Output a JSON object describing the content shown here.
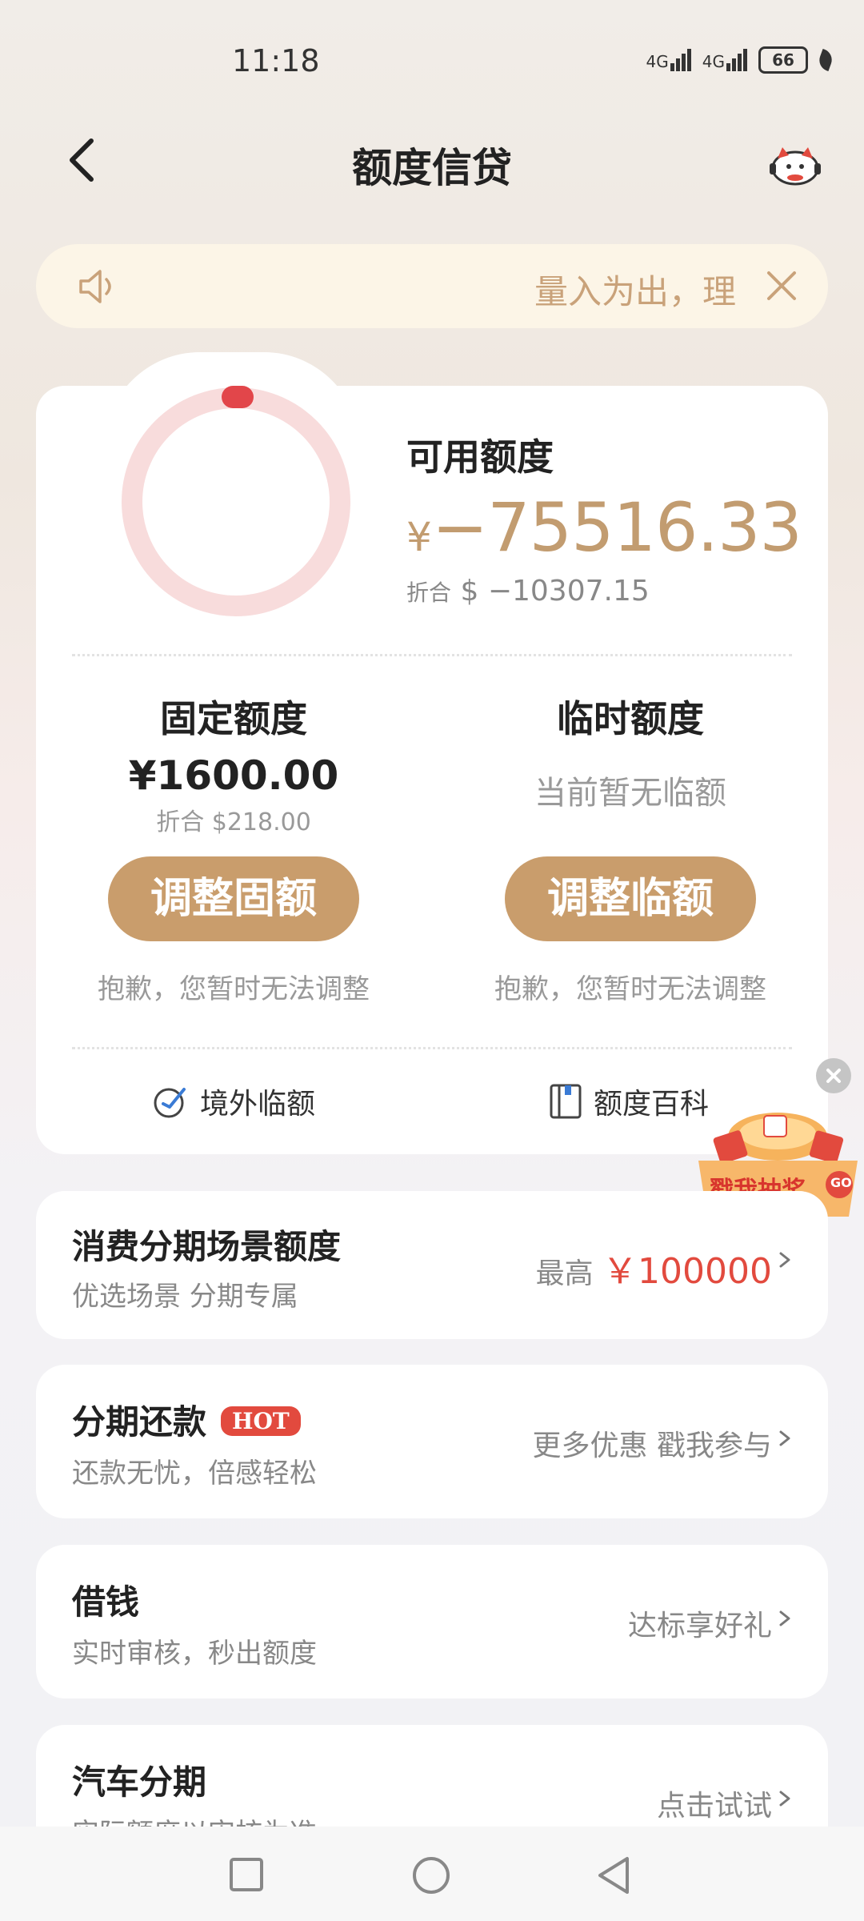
{
  "status": {
    "time": "11:18",
    "signal1": "4G",
    "signal2": "4G",
    "battery": "66"
  },
  "header": {
    "title": "额度信贷"
  },
  "notice": {
    "text": "量入为出，理"
  },
  "credit": {
    "available_label": "可用额度",
    "available_currency": "¥",
    "available_amount": "−75516.33",
    "conv_prefix": "折合",
    "conv_value": "$ −10307.15",
    "fixed": {
      "title": "固定额度",
      "amount": "¥1600.00",
      "conv": "折合 $218.00",
      "button": "调整固额",
      "note": "抱歉，您暂时无法调整"
    },
    "temporary": {
      "title": "临时额度",
      "status": "当前暂无临额",
      "button": "调整临额",
      "note": "抱歉，您暂时无法调整"
    },
    "links": {
      "overseas": "境外临额",
      "wiki": "额度百科"
    }
  },
  "lottery": {
    "label": "戳我抽奖",
    "go": "GO"
  },
  "rows": [
    {
      "title": "消费分期场景额度",
      "sub": "优选场景 分期专属",
      "right_prefix": "最高",
      "right_value": "￥100000"
    },
    {
      "title": "分期还款",
      "badge": "HOT",
      "sub": "还款无忧，倍感轻松",
      "right": "更多优惠 戳我参与"
    },
    {
      "title": "借钱",
      "sub": "实时审核，秒出额度",
      "right": "达标享好礼"
    },
    {
      "title": "汽车分期",
      "sub": "实际额度以审核为准",
      "right": "点击试试"
    }
  ],
  "colors": {
    "accent": "#c99d6c",
    "gold_text": "#c29c70",
    "red": "#e24a3e",
    "ring": "#f8dcdc"
  }
}
